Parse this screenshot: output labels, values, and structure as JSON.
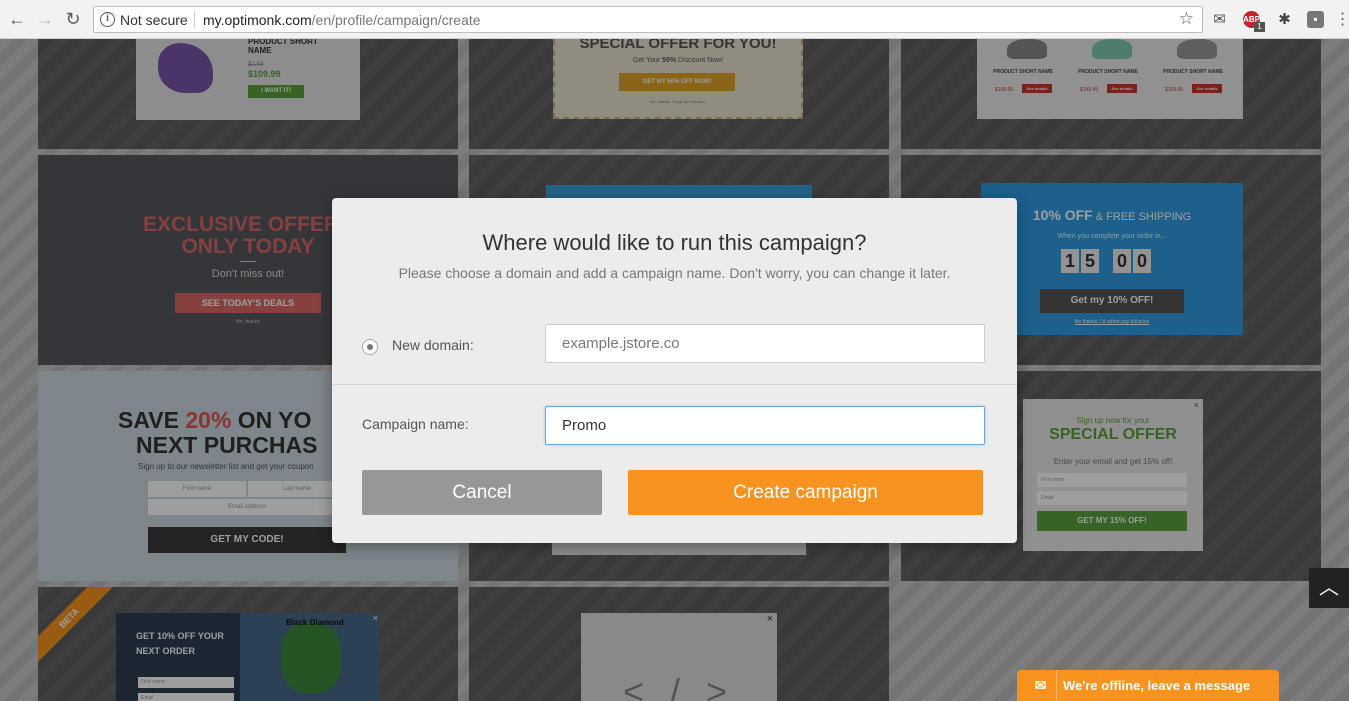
{
  "browser": {
    "security": "Not secure",
    "url_host": "my.optimonk.com",
    "url_path": "/en/profile/campaign/create",
    "abp_badge": "1"
  },
  "templates": {
    "t1": {
      "title": "PRODUCT SHORT NAME",
      "old_price": "$149",
      "price": "$109.99",
      "cta": "I WANT IT!"
    },
    "t2": {
      "title": "SPECIAL OFFER FOR YOU!",
      "sub_prefix": "Get Your ",
      "sub_bold": "50%",
      "sub_suffix": " Discount Now!",
      "cta": "GET MY 50% OFF NOW!",
      "decline": "No, thanks, I'll pay the full price"
    },
    "t3": {
      "names": [
        "PRODUCT SHORT NAME",
        "PRODUCT SHORT NAME",
        "PRODUCT SHORT NAME"
      ],
      "prices": [
        "$109.99",
        "$149.49",
        "$109.99"
      ],
      "cta": "See details"
    },
    "t4": {
      "line1": "EXCLUSIVE OFFERS",
      "line2": "ONLY TODAY",
      "sub": "Don't miss out!",
      "cta": "SEE TODAY'S DEALS",
      "decline": "No, thanks"
    },
    "t6": {
      "headline": "10% OFF",
      "headline_rest": " & FREE SHIPPING",
      "sub": "When you complete your order in...",
      "digits": [
        "1",
        "5",
        "0",
        "0"
      ],
      "cta": "Get my 10% OFF!",
      "decline": "No thanks, I'd rather pay full price"
    },
    "t7": {
      "line1a": "SAVE ",
      "line1b": "20%",
      "line1c": " ON YO",
      "line2": "NEXT PURCHAS",
      "sub": "Sign up to our newsletter list and get your coupon",
      "first": "First name",
      "last": "Last name",
      "email": "Email address",
      "cta": "GET MY CODE!"
    },
    "t9": {
      "pre": "Sign up now for your",
      "title": "SPECIAL OFFER",
      "sub": "Enter your email and get 15% off!",
      "first": "First name",
      "email": "Email",
      "cta": "GET MY 15% OFF!"
    },
    "t10": {
      "ribbon": "BETA",
      "line1": "GET 10% OFF YOUR",
      "line2": "NEXT ORDER",
      "brand": "Black Diamond",
      "field1": "First name",
      "field2": "Email"
    },
    "t11": {
      "code_symbol": "< / >"
    }
  },
  "modal": {
    "title": "Where would like to run this campaign?",
    "subtitle": "Please choose a domain and add a campaign name. Don't worry, you can change it later.",
    "domain_label": "New domain:",
    "domain_placeholder": "example.jstore.co",
    "name_label": "Campaign name:",
    "name_value": "Promo",
    "cancel_label": "Cancel",
    "create_label": "Create campaign"
  },
  "chat": {
    "label": "We're offline, leave a message"
  },
  "colors": {
    "accent": "#f7931e",
    "cancel": "#979797",
    "red_text": "#e05552",
    "green": "#5aa03a",
    "blue": "#3ba2de"
  }
}
